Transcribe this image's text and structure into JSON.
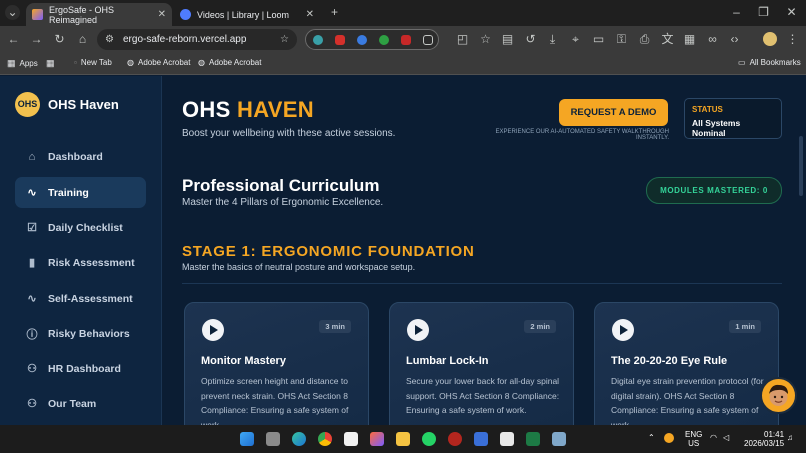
{
  "browser": {
    "tabs": [
      {
        "title": "ErgoSafe - OHS Reimagined",
        "active": true
      },
      {
        "title": "Videos | Library | Loom",
        "active": false
      }
    ],
    "url": "ergo-safe-reborn.vercel.app",
    "bookmarks": [
      "Apps",
      "New Tab",
      "Adobe Acrobat",
      "Adobe Acrobat"
    ],
    "all_bookmarks": "All Bookmarks"
  },
  "sidebar": {
    "logo": "OHS",
    "brand": "OHS Haven",
    "items": [
      {
        "label": "Dashboard",
        "icon": "home-icon",
        "active": false
      },
      {
        "label": "Training",
        "icon": "activity-icon",
        "active": true
      },
      {
        "label": "Daily Checklist",
        "icon": "checkbox-icon",
        "active": false
      },
      {
        "label": "Risk Assessment",
        "icon": "bar-chart-icon",
        "active": false
      },
      {
        "label": "Self-Assessment",
        "icon": "pulse-icon",
        "active": false
      },
      {
        "label": "Risky Behaviors",
        "icon": "alert-circle-icon",
        "active": false
      },
      {
        "label": "HR Dashboard",
        "icon": "users-icon",
        "active": false
      },
      {
        "label": "Our Team",
        "icon": "team-icon",
        "active": false
      }
    ]
  },
  "hero": {
    "title_main": "OHS ",
    "title_accent": "HAVEN",
    "subtitle": "Boost your wellbeing with these active sessions.",
    "demo_button": "REQUEST A DEMO",
    "demo_note": "EXPERIENCE OUR AI-AUTOMATED SAFETY WALKTHROUGH INSTANTLY.",
    "status_label": "STATUS",
    "status_value": "All Systems Nominal"
  },
  "curriculum": {
    "title": "Professional Curriculum",
    "subtitle": "Master the 4 Pillars of Ergonomic Excellence.",
    "mastered": "MODULES MASTERED: 0"
  },
  "stage": {
    "title": "STAGE 1: ERGONOMIC FOUNDATION",
    "subtitle": "Master the basics of neutral posture and workspace setup."
  },
  "cards": [
    {
      "duration": "3 min",
      "title": "Monitor Mastery",
      "description": "Optimize screen height and distance to prevent neck strain. OHS Act Section 8 Compliance: Ensuring a safe system of work."
    },
    {
      "duration": "2 min",
      "title": "Lumbar Lock-In",
      "description": "Secure your lower back for all-day spinal support. OHS Act Section 8 Compliance: Ensuring a safe system of work."
    },
    {
      "duration": "1 min",
      "title": "The 20-20-20 Eye Rule",
      "description": "Digital eye strain prevention protocol (for digital strain). OHS Act Section 8 Compliance: Ensuring a safe system of work."
    }
  ],
  "taskbar": {
    "lang_top": "ENG",
    "lang_bottom": "US",
    "time": "01:41",
    "date": "2026/03/15"
  },
  "colors": {
    "accent": "#f5a623",
    "background": "#0b1d33",
    "sidebar": "#0e2540",
    "success": "#34d399"
  }
}
